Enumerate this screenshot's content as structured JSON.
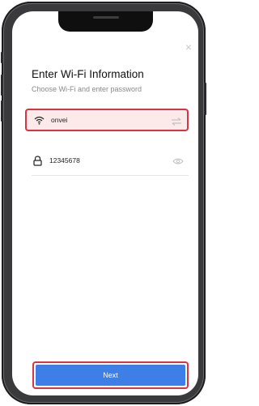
{
  "header": {
    "title": "Enter Wi-Fi Information",
    "subtitle": "Choose Wi-Fi and enter password",
    "close_glyph": "×"
  },
  "wifi": {
    "ssid": "onvei",
    "icon": "wifi-icon",
    "switch_icon": "switch-network-icon"
  },
  "password": {
    "value": "12345678",
    "icon": "lock-icon",
    "toggle_icon": "eye-icon"
  },
  "footer": {
    "next_label": "Next"
  },
  "colors": {
    "accent": "#3d7fe6",
    "highlight_border": "#d93444",
    "highlight_fill": "#fce9e9"
  }
}
